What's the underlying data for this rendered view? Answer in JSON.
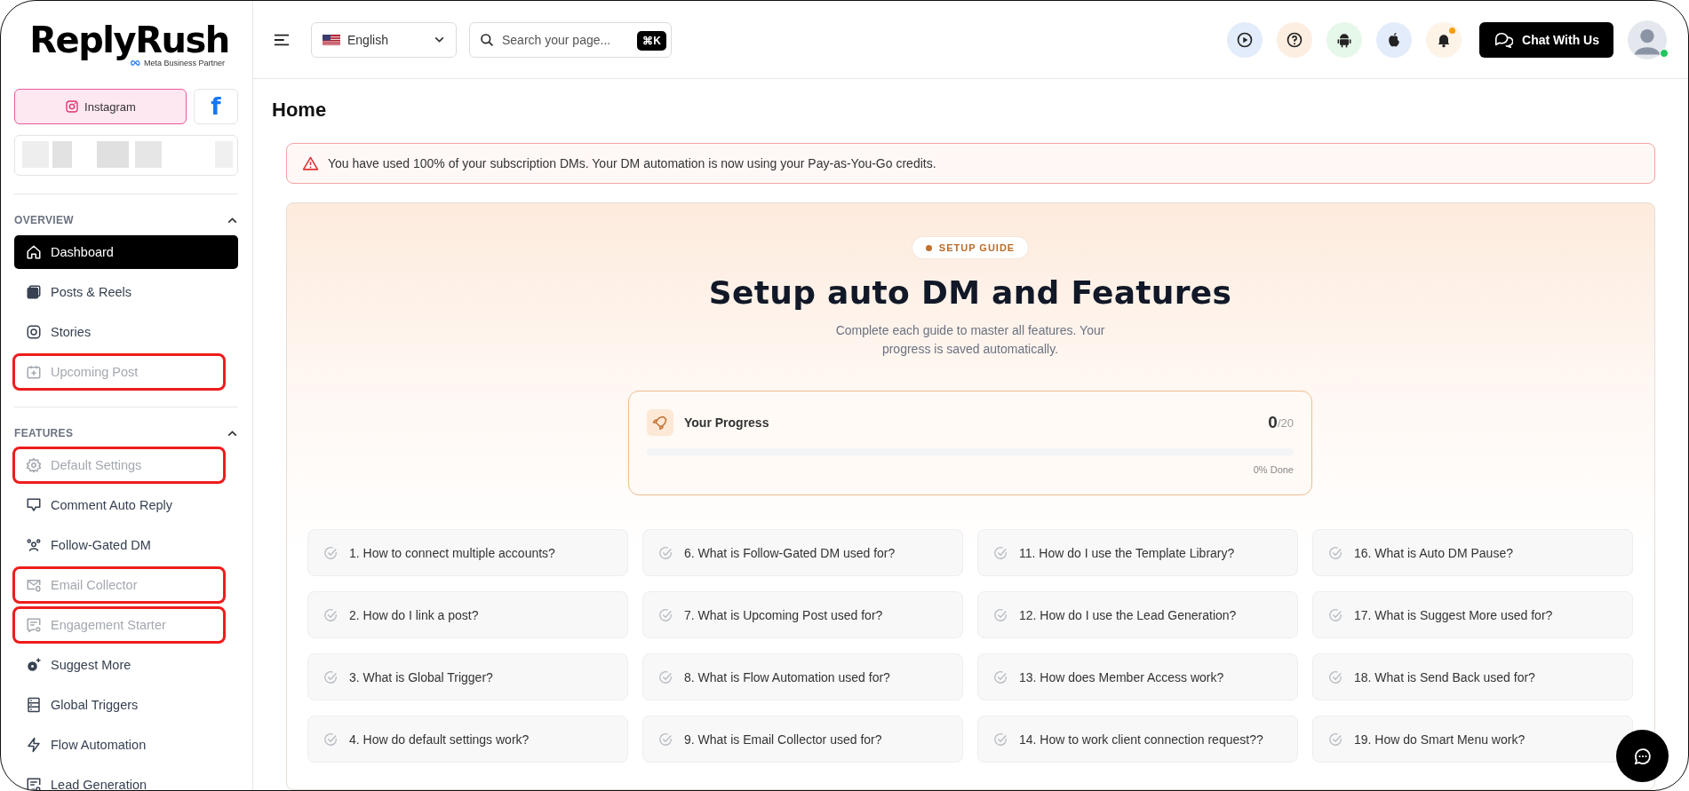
{
  "brand": {
    "logo": "ReplyRush",
    "partner": "Meta Business Partner"
  },
  "platform_tabs": [
    {
      "label": "Instagram",
      "kind": "instagram",
      "selected": true
    },
    {
      "label": "f",
      "kind": "facebook",
      "selected": false
    }
  ],
  "sidebar": {
    "sections": [
      {
        "title": "OVERVIEW",
        "expanded": true,
        "items": [
          {
            "label": "Dashboard",
            "kind": "home",
            "selected": true,
            "disabled": false,
            "highlighted": false
          },
          {
            "label": "Posts & Reels",
            "kind": "images",
            "selected": false,
            "disabled": false,
            "highlighted": false
          },
          {
            "label": "Stories",
            "kind": "instagram",
            "selected": false,
            "disabled": false,
            "highlighted": false
          },
          {
            "label": "Upcoming Post",
            "kind": "calendar",
            "selected": false,
            "disabled": true,
            "highlighted": true
          }
        ]
      },
      {
        "title": "FEATURES",
        "expanded": true,
        "items": [
          {
            "label": "Default Settings",
            "kind": "gear",
            "selected": false,
            "disabled": true,
            "highlighted": true
          },
          {
            "label": "Comment Auto Reply",
            "kind": "comments",
            "selected": false,
            "disabled": false,
            "highlighted": false
          },
          {
            "label": "Follow-Gated DM",
            "kind": "people",
            "selected": false,
            "disabled": false,
            "highlighted": false
          },
          {
            "label": "Email Collector",
            "kind": "mail",
            "selected": false,
            "disabled": true,
            "highlighted": true
          },
          {
            "label": "Engagement Starter",
            "kind": "chat",
            "selected": false,
            "disabled": true,
            "highlighted": true
          },
          {
            "label": "Suggest More",
            "kind": "sparkgear",
            "selected": false,
            "disabled": false,
            "highlighted": false
          },
          {
            "label": "Global Triggers",
            "kind": "server",
            "selected": false,
            "disabled": false,
            "highlighted": false
          },
          {
            "label": "Flow Automation",
            "kind": "bolt",
            "selected": false,
            "disabled": false,
            "highlighted": false
          },
          {
            "label": "Lead Generation",
            "kind": "chat",
            "selected": false,
            "disabled": false,
            "highlighted": false
          }
        ]
      }
    ]
  },
  "header": {
    "language": "English",
    "search": {
      "placeholder": "Search your page...",
      "shortcut": "⌘K"
    },
    "icon_buttons": [
      {
        "kind": "play",
        "color": "#e3ecfb"
      },
      {
        "kind": "help",
        "color": "#fdeee2"
      },
      {
        "kind": "android",
        "color": "#e6f8ea"
      },
      {
        "kind": "apple",
        "color": "#e3ecfb"
      },
      {
        "kind": "bell",
        "color": "#fdf3e6"
      }
    ],
    "notification_unread": true,
    "chat_button": "Chat With Us",
    "avatar_online": true
  },
  "page_title": "Home",
  "alert": "You have used 100% of your subscription DMs. Your DM automation is now using your Pay-as-You-Go credits.",
  "setup_guide": {
    "badge": "SETUP GUIDE",
    "heading": "Setup auto DM and Features",
    "subtitle": "Complete each guide to master all features. Your progress is saved automatically.",
    "progress": {
      "label": "Your Progress",
      "count": "0",
      "total": "/20",
      "done": "0% Done"
    },
    "guide_columns": [
      {
        "items": [
          {
            "label": "1. How to connect multiple accounts?",
            "checked": false
          },
          {
            "label": "2. How do I link a post?",
            "checked": false
          },
          {
            "label": "3. What is Global Trigger?",
            "checked": false
          },
          {
            "label": "4. How do default settings work?",
            "checked": false
          }
        ]
      },
      {
        "items": [
          {
            "label": "6. What is Follow-Gated DM used for?",
            "checked": false
          },
          {
            "label": "7. What is Upcoming Post used for?",
            "checked": false
          },
          {
            "label": "8. What is Flow Automation used for?",
            "checked": false
          },
          {
            "label": "9. What is Email Collector used for?",
            "checked": false
          }
        ]
      },
      {
        "items": [
          {
            "label": "11. How do I use the Template Library?",
            "checked": false
          },
          {
            "label": "12. How do I use the Lead Generation?",
            "checked": false
          },
          {
            "label": "13. How does Member Access work?",
            "checked": false
          },
          {
            "label": "14. How to work client connection request??",
            "checked": false
          }
        ]
      },
      {
        "items": [
          {
            "label": "16. What is Auto DM Pause?",
            "checked": false
          },
          {
            "label": "17. What is Suggest More used for?",
            "checked": false
          },
          {
            "label": "18. What is Send Back used for?",
            "checked": false
          },
          {
            "label": "19. How do Smart Menu work?",
            "checked": false
          }
        ]
      }
    ]
  }
}
